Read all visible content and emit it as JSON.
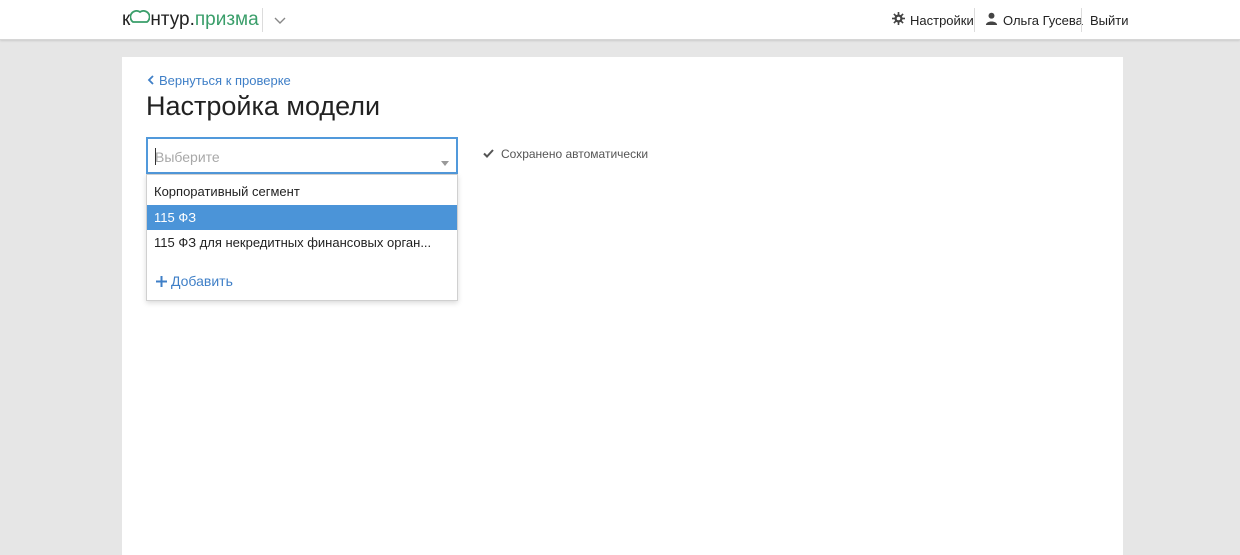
{
  "header": {
    "logo": {
      "brand_prefix": "к",
      "brand_suffix": "нтур",
      "dot": ".",
      "product": "призма"
    },
    "settings_label": "Настройки",
    "user_name": "Ольга Гусева",
    "logout_label": "Выйти"
  },
  "page": {
    "back_link": "Вернуться к проверке",
    "title": "Настройка модели"
  },
  "model_select": {
    "value": "",
    "placeholder": "Выберите"
  },
  "save_status": "Сохранено автоматически",
  "dropdown": {
    "options": [
      {
        "label": "Корпоративный сегмент",
        "highlighted": false
      },
      {
        "label": "115 ФЗ",
        "highlighted": true
      },
      {
        "label": "115 ФЗ для некредитных финансовых орган...",
        "highlighted": false
      }
    ],
    "add_label": "Добавить"
  },
  "colors": {
    "accent": "#3f7fc7",
    "highlight": "#4b94d8",
    "brand_green": "#3a9e6a",
    "focus_border": "#5199db"
  },
  "icons": {
    "product_menu": "chevron-down-icon",
    "settings": "gear-icon",
    "user": "user-icon",
    "back": "chevron-left-icon",
    "select_arrow": "caret-down-icon",
    "saved": "checkmark-icon",
    "add": "plus-icon"
  }
}
